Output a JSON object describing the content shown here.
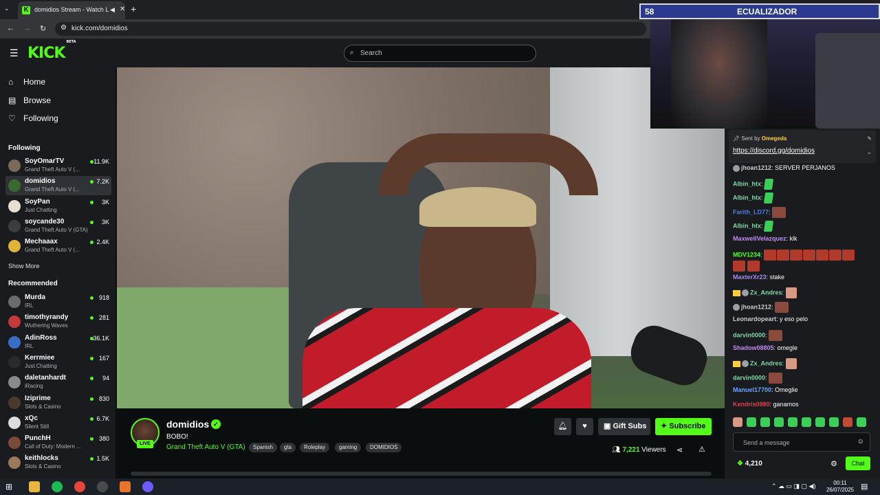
{
  "browser": {
    "tab_title": "domidios Stream - Watch L",
    "url": "kick.com/domidios"
  },
  "overlay": {
    "number": "58",
    "label": "ECUALIZADOR"
  },
  "header": {
    "logo": "KICK",
    "logo_badge": "BETA",
    "search_placeholder": "Search"
  },
  "sidebar": {
    "nav": [
      {
        "label": "Home",
        "icon": "home-icon"
      },
      {
        "label": "Browse",
        "icon": "browse-icon"
      },
      {
        "label": "Following",
        "icon": "heart-icon"
      }
    ],
    "following_title": "Following",
    "following": [
      {
        "name": "SoyOmarTV",
        "game": "Grand Theft Auto V (...",
        "viewers": "11.9K",
        "color": "#7a6a5a"
      },
      {
        "name": "domidios",
        "game": "Grand Theft Auto V (...",
        "viewers": "7.2K",
        "color": "#3b6a2e",
        "active": true
      },
      {
        "name": "SoyPan",
        "game": "Just Chatting",
        "viewers": "3K",
        "color": "#e6e0d4"
      },
      {
        "name": "soycande30",
        "game": "Grand Theft Auto V (GTA)",
        "viewers": "3K",
        "color": "#3d3d3d"
      },
      {
        "name": "Mechaaax",
        "game": "Grand Theft Auto V (...",
        "viewers": "2.4K",
        "color": "#e0b33a"
      }
    ],
    "show_more": "Show More",
    "recommended_title": "Recommended",
    "recommended": [
      {
        "name": "Murda",
        "game": "IRL",
        "viewers": "918",
        "color": "#6b6b6b"
      },
      {
        "name": "timothyrandy",
        "game": "Wuthering Waves",
        "viewers": "281",
        "color": "#c43a3a"
      },
      {
        "name": "AdinRoss",
        "game": "IRL",
        "viewers": "36.1K",
        "color": "#3a6ec4"
      },
      {
        "name": "Kerrmiee",
        "game": "Just Chatting",
        "viewers": "167",
        "color": "#2a2a2a"
      },
      {
        "name": "daletanhardt",
        "game": "iRacing",
        "viewers": "94",
        "color": "#8a8a8a"
      },
      {
        "name": "Iziprime",
        "game": "Slots & Casino",
        "viewers": "830",
        "color": "#4a3a2a"
      },
      {
        "name": "xQc",
        "game": "Silent Still",
        "viewers": "6.7K",
        "color": "#dcdcdc"
      },
      {
        "name": "PunchH",
        "game": "Call of Duty: Modern ...",
        "viewers": "380",
        "color": "#7a4a3a"
      },
      {
        "name": "keithlocks",
        "game": "Slots & Casino",
        "viewers": "1.5K",
        "color": "#9a7a5a"
      }
    ]
  },
  "stream": {
    "name": "domidios",
    "live": "LIVE",
    "title": "BOBO!",
    "category": "Grand Theft Auto V (GTA)",
    "tags": [
      "Spanish",
      "gta",
      "Roleplay",
      "gaming",
      "DOMIDIOS"
    ],
    "gift_subs": "Gift Subs",
    "subscribe": "Subscribe",
    "viewers_count": "7,221",
    "viewers_label": "Viewers"
  },
  "chat": {
    "pinned_sent_by": "Sent by",
    "pinned_user": "Omegeda",
    "pinned_link": "https://discord.gg/domidios",
    "messages": [
      {
        "user": "jhoan1212",
        "color": "#c9cbcf",
        "text": "SERVER PERJANOS",
        "badge": "i"
      },
      {
        "user": "Albin_htx",
        "color": "#7dd8a0",
        "text": "",
        "emotes": "green"
      },
      {
        "user": "Albin_htx",
        "color": "#7dd8a0",
        "text": "",
        "emotes": "green"
      },
      {
        "user": "Farith_LD77",
        "color": "#4e7ee8",
        "text": "",
        "emotes": "face"
      },
      {
        "user": "Albin_htx",
        "color": "#7dd8a0",
        "text": "",
        "emotes": "green"
      },
      {
        "user": "MaxwellVelazquez",
        "color": "#c08aef",
        "text": "klk"
      },
      {
        "user": "MDV1234",
        "color": "#53fc18",
        "text": "",
        "emotes": "reds"
      },
      {
        "user": "MaxterXr23",
        "color": "#a88ae8",
        "text": "stake"
      },
      {
        "user": "Zx_Andres",
        "color": "#7dd8a0",
        "text": "",
        "emotes": "hand",
        "badge": "ci"
      },
      {
        "user": "jhoan1212",
        "color": "#c9cbcf",
        "text": "",
        "emotes": "face",
        "badge": "i"
      },
      {
        "user": "Leonardopeart",
        "color": "#c9cbcf",
        "text": "y eso pelo"
      },
      {
        "user": "darvin0000",
        "color": "#7dd8a0",
        "text": "",
        "emotes": "face"
      },
      {
        "user": "Shadow08805",
        "color": "#c08aef",
        "text": "omegle"
      },
      {
        "user": "Zx_Andres",
        "color": "#7dd8a0",
        "text": "",
        "emotes": "hand",
        "badge": "ci"
      },
      {
        "user": "darvin0000",
        "color": "#7dd8a0",
        "text": "",
        "emotes": "face"
      },
      {
        "user": "Manuel17700",
        "color": "#6aa6ff",
        "text": "Omeglie"
      },
      {
        "user": "Kendris0880",
        "color": "#e8384a",
        "text": "ganamos"
      }
    ],
    "input_placeholder": "Send a message",
    "points": "4,210",
    "chat_button": "Chat"
  },
  "taskbar": {
    "time": "00:11",
    "date": "26/07/2025"
  }
}
